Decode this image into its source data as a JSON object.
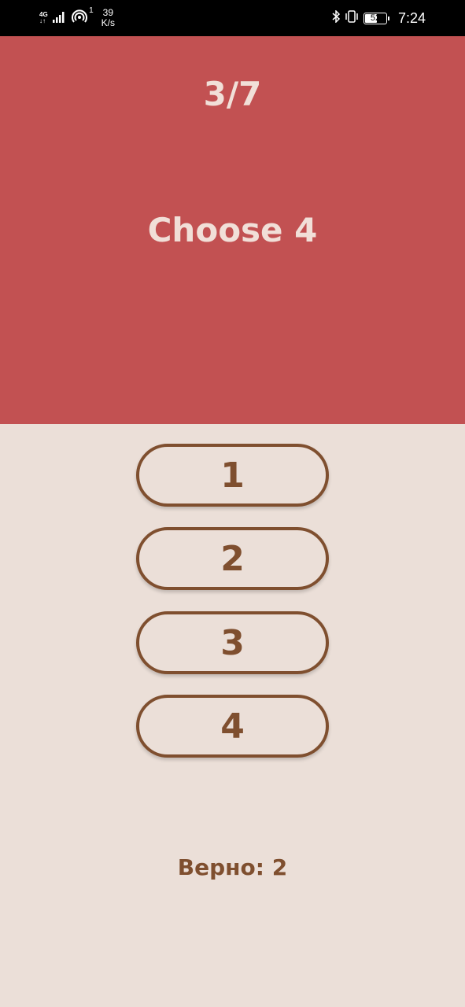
{
  "status_bar": {
    "network_type_top": "4G",
    "network_type_bottom": "↓↑",
    "hotspot_count": "1",
    "speed_value": "39",
    "speed_unit": "K/s",
    "battery_level": "52",
    "time": "7:24",
    "icons": [
      "signal-icon",
      "hotspot-icon",
      "bluetooth-icon",
      "vibrate-icon",
      "battery-icon"
    ]
  },
  "quiz": {
    "progress": "3/7",
    "prompt": "Choose 4",
    "answers": [
      "1",
      "2",
      "3",
      "4"
    ],
    "score_text": "Верно: 2"
  },
  "colors": {
    "header_bg": "#c25152",
    "body_bg": "#ebdfd8",
    "accent_brown": "#7f4f2f",
    "header_text": "#f1dfd8"
  }
}
